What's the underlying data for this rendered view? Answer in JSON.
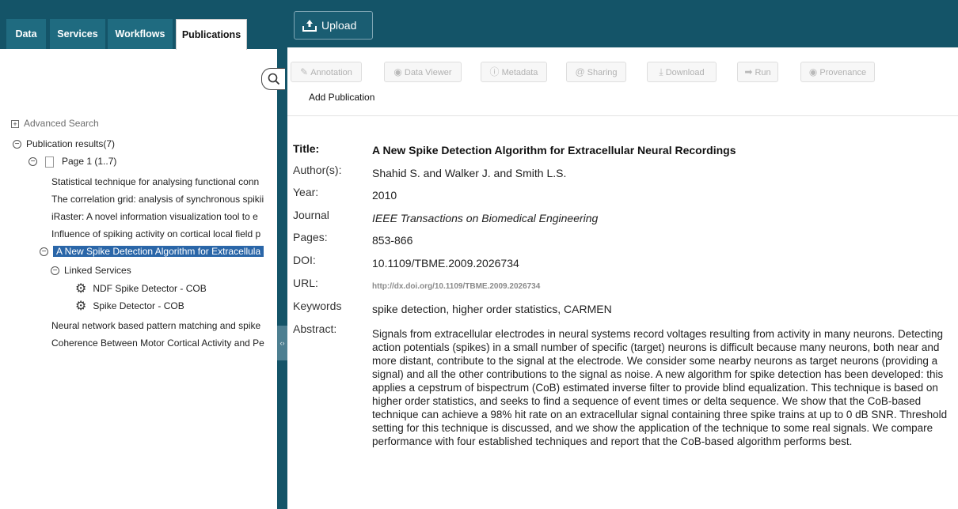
{
  "tabs": [
    {
      "label": "Data"
    },
    {
      "label": "Services"
    },
    {
      "label": "Workflows"
    },
    {
      "label": "Publications"
    }
  ],
  "tree": {
    "advanced_search": "Advanced Search",
    "results_label": "Publication results(7)",
    "page_label": "Page 1 (1..7)",
    "items": [
      "Statistical technique for analysing functional conn",
      "The correlation grid: analysis of synchronous spikii",
      "iRaster: A novel information visualization tool to e",
      "Influence of spiking activity on cortical local field p"
    ],
    "selected_item": "A New Spike Detection Algorithm for Extracellula",
    "linked_services_label": "Linked Services",
    "services": [
      "NDF Spike Detector - COB",
      "Spike Detector - COB"
    ],
    "after_items": [
      "Neural network based pattern matching and spike",
      "Coherence Between Motor Cortical Activity and Pe"
    ]
  },
  "top_bar": {
    "upload_label": "Upload"
  },
  "toolbar": {
    "annotation": "Annotation",
    "data_viewer": "Data Viewer",
    "metadata": "Metadata",
    "sharing": "Sharing",
    "download": "Download",
    "run": "Run",
    "provenance": "Provenance",
    "add_publication": "Add Publication"
  },
  "publication": {
    "labels": {
      "title": "Title:",
      "authors": "Author(s):",
      "year": "Year:",
      "journal": "Journal",
      "pages": "Pages:",
      "doi": "DOI:",
      "url": "URL:",
      "keywords": "Keywords",
      "abstract": "Abstract:"
    },
    "title": "A New Spike Detection Algorithm for Extracellular Neural Recordings",
    "authors": "Shahid S. and Walker J. and Smith L.S.",
    "year": "2010",
    "journal": "IEEE Transactions on Biomedical Engineering",
    "pages": "853-866",
    "doi": "10.1109/TBME.2009.2026734",
    "url": "http://dx.doi.org/10.1109/TBME.2009.2026734",
    "keywords": "spike detection, higher order statistics, CARMEN",
    "abstract": "Signals from extracellular electrodes in neural systems record voltages resulting from activity in many neurons. Detecting action potentials (spikes) in a small number of specific (target) neurons is difficult because many neurons, both near and more distant, contribute to the signal at the electrode. We consider some nearby neurons as target neurons (providing a signal) and all the other contributions to the signal as noise. A new algorithm for spike detection has been developed: this applies a cepstrum of bispectrum (CoB) estimated inverse filter to provide blind equalization. This technique is based on higher order statistics, and seeks to find a sequence of event times or delta sequence. We show that the CoB-based technique can achieve a 98% hit rate on an extracellular signal containing three spike trains at up to 0 dB SNR. Threshold setting for this technique is discussed, and we show the application of the technique to some real signals. We compare performance with four established techniques and report that the CoB-based algorithm performs best."
  },
  "colors": {
    "header_bg": "#145468",
    "selection_bg": "#2a66a8"
  }
}
